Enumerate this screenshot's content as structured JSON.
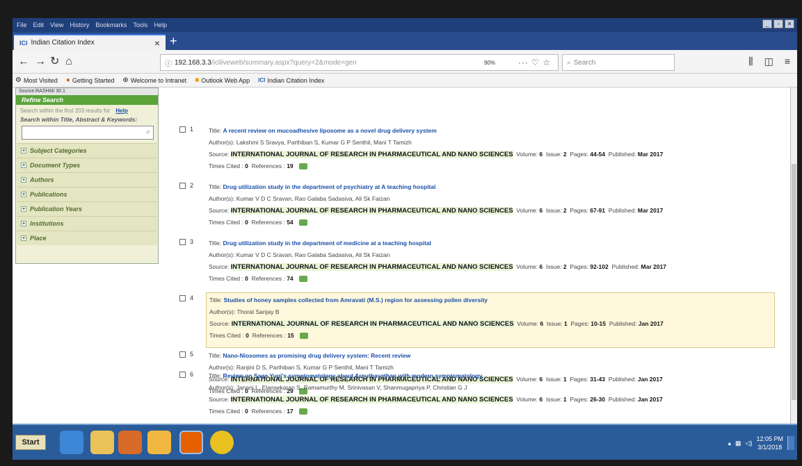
{
  "browser": {
    "menu": [
      "File",
      "Edit",
      "View",
      "History",
      "Bookmarks",
      "Tools",
      "Help"
    ],
    "tab_title": "Indian Citation Index",
    "tab_icon": "ICI",
    "url_host": "192.168.3.3",
    "url_path": "/iciliveweb/summary.aspx?query=2&mode=gen",
    "zoom": "90%",
    "search_placeholder": "Search",
    "bookmarks": [
      "Most Visited",
      "Getting Started",
      "Welcome to Intranet",
      "Outlook Web App",
      "Indian Citation Index"
    ]
  },
  "sidebar": {
    "source_line": "Source:RASHMI 30.1",
    "header": "Refine Search",
    "hint": "Search within the first 203 results for",
    "help": "Help",
    "keywords_label": "Search within Title, Abstract & Keywords:",
    "facets": [
      "Subject Categories",
      "Document Types",
      "Authors",
      "Publications",
      "Publication Years",
      "Institutions",
      "Place"
    ]
  },
  "labels": {
    "title": "Title:",
    "authors": "Author(s):",
    "source": "Source:",
    "volume": "Volume:",
    "issue": "Issue:",
    "pages": "Pages:",
    "published": "Published:",
    "times_cited": "Times Cited :",
    "references": "References :"
  },
  "results": [
    {
      "num": "1",
      "title": "A recent review on mucoadhesive liposome as a novel drug delivery system",
      "authors": "Lakshmi S Sravya, Parthiban S, Kumar G P Senthil, Mani T Tamizh",
      "source": "INTERNATIONAL JOURNAL OF RESEARCH IN PHARMACEUTICAL AND NANO SCIENCES",
      "volume": "6",
      "issue": "2",
      "pages": "44-54",
      "published": "Mar 2017",
      "cited": "0",
      "refs": "19"
    },
    {
      "num": "2",
      "title": "Drug utilization study in the department of psychiatry at A teaching hospital",
      "authors": "Kumar V D C Sravan, Rao Galaba Sadasiva, Ali Sk Faizan",
      "source": "INTERNATIONAL JOURNAL OF RESEARCH IN PHARMACEUTICAL AND NANO SCIENCES",
      "volume": "6",
      "issue": "2",
      "pages": "67-91",
      "published": "Mar 2017",
      "cited": "0",
      "refs": "54"
    },
    {
      "num": "3",
      "title": "Drug utilization study in the department of medicine at a teaching hospital",
      "authors": "Kumar V D C Sravan, Rao Galaba Sadasiva, Ali Sk Faizan",
      "source": "INTERNATIONAL JOURNAL OF RESEARCH IN PHARMACEUTICAL AND NANO SCIENCES",
      "volume": "6",
      "issue": "2",
      "pages": "92-102",
      "published": "Mar 2017",
      "cited": "0",
      "refs": "74"
    },
    {
      "num": "4",
      "title": "Studies of honey samples collected from Amravati (M.S.) region for assessing pollen diversity",
      "authors": "Thorat Sanjay B",
      "source": "INTERNATIONAL JOURNAL OF RESEARCH IN PHARMACEUTICAL AND NANO SCIENCES",
      "volume": "6",
      "issue": "1",
      "pages": "10-15",
      "published": "Jan 2017",
      "cited": "0",
      "refs": "15"
    },
    {
      "num": "5",
      "title": "Nano-Niosomes as promising drug delivery system: Recent review",
      "authors": "Ranjini D S, Parthiban S, Kumar G P Senthil, Mani T Tamizh",
      "source": "INTERNATIONAL JOURNAL OF RESEARCH IN PHARMACEUTICAL AND NANO SCIENCES",
      "volume": "6",
      "issue": "1",
      "pages": "31-43",
      "published": "Jan 2017",
      "cited": "0",
      "refs": "29"
    },
    {
      "num": "6",
      "title": "Review on Sage Yugi's symptomatology about Arputhavathan with modern symptomatology",
      "authors": "Janani L, Elansekaran S, Ramamurthy M, Srinivasan V, Shanmugapriya P, Christian G J",
      "source": "INTERNATIONAL JOURNAL OF RESEARCH IN PHARMACEUTICAL AND NANO SCIENCES",
      "volume": "6",
      "issue": "1",
      "pages": "26-30",
      "published": "Jan 2017",
      "cited": "0",
      "refs": "17"
    }
  ],
  "taskbar": {
    "start": "Start",
    "time": "12:05 PM",
    "date": "3/1/2018"
  },
  "colors": {
    "accent": "#1a4fa8",
    "refine_green": "#5aa43a",
    "highlight": "#fff8dc"
  }
}
